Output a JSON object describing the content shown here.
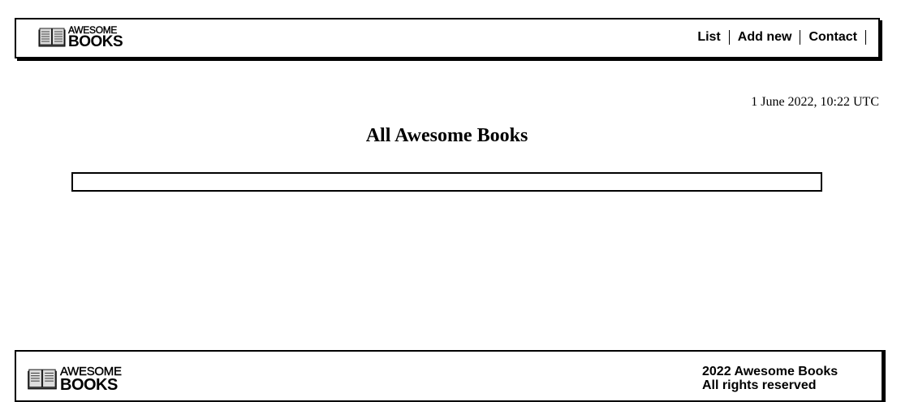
{
  "header": {
    "logo": {
      "line1": "AWESOME",
      "line2": "BOOKS",
      "icon": "open-book-icon"
    },
    "nav": [
      {
        "label": "List"
      },
      {
        "label": "Add new"
      },
      {
        "label": "Contact"
      }
    ]
  },
  "main": {
    "timestamp": "1 June 2022, 10:22 UTC",
    "title": "All Awesome Books"
  },
  "footer": {
    "logo": {
      "line1": "AWESOME",
      "line2": "BOOKS",
      "icon": "open-book-icon"
    },
    "copyright_line1": "2022 Awesome Books",
    "copyright_line2": "All rights reserved"
  },
  "colors": {
    "border": "#000000",
    "background": "#ffffff"
  }
}
